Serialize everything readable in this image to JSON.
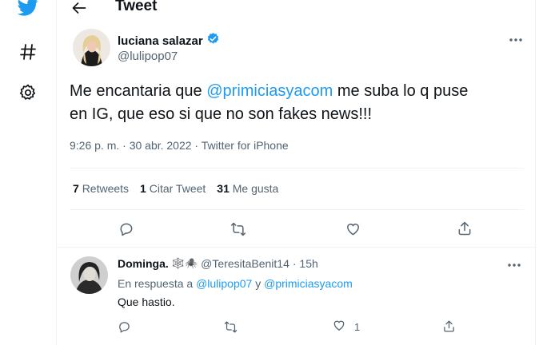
{
  "header": {
    "title": "Tweet"
  },
  "tweet": {
    "author_name": "luciana salazar",
    "author_handle": "@lulipop07",
    "text_before": "Me encantaria que ",
    "mention": "@primiciasyacom",
    "text_after": " me suba lo q puse en IG, que eso si que no son fakes news!!!",
    "meta": "9:26 p. m. · 30 abr. 2022 · Twitter for iPhone",
    "stats": [
      {
        "count": "7",
        "label": "Retweets"
      },
      {
        "count": "1",
        "label": "Citar Tweet"
      },
      {
        "count": "31",
        "label": "Me gusta"
      }
    ]
  },
  "reply": {
    "author_name": "Dominga.",
    "author_emoji": "🕸️🕷️",
    "author_handle": "@TeresitaBenit14",
    "time": "· 15h",
    "replying_prefix": "En respuesta a",
    "replying_to_1": "@lulipop07",
    "replying_and": "y",
    "replying_to_2": "@primiciasyacom",
    "text": "Que hastio.",
    "like_count": "1"
  },
  "colors": {
    "accent": "#1d9bf0",
    "muted": "#536471",
    "text": "#0f1419",
    "divider": "#eff3f4"
  },
  "icons": [
    "twitter-bird-icon",
    "hashtag-icon",
    "settings-gear-icon",
    "back-arrow-icon",
    "verified-badge-icon",
    "more-icon",
    "reply-icon",
    "retweet-icon",
    "like-icon",
    "share-icon"
  ]
}
